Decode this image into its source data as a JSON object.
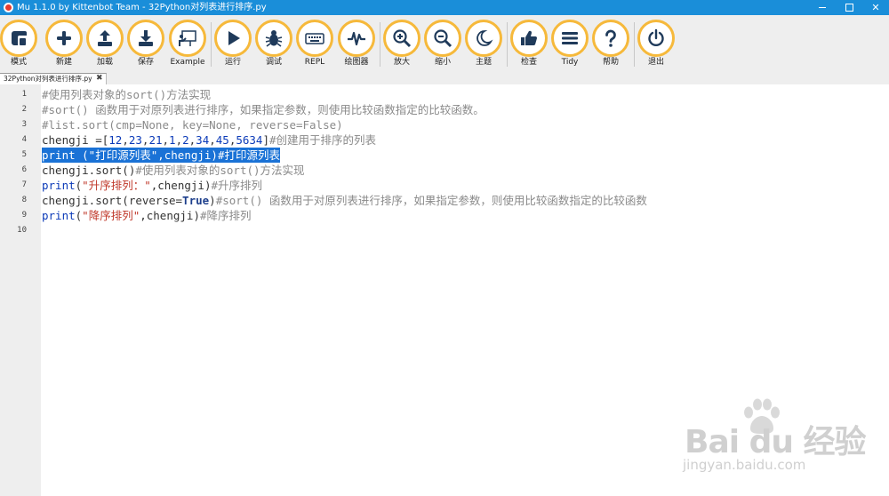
{
  "window": {
    "title": "Mu 1.1.0 by Kittenbot Team - 32Python对列表进行排序.py"
  },
  "toolbar": {
    "buttons": [
      {
        "label": "模式",
        "icon": "mode-icon"
      },
      {
        "label": "新建",
        "icon": "plus-icon"
      },
      {
        "label": "加载",
        "icon": "upload-icon"
      },
      {
        "label": "保存",
        "icon": "download-icon"
      },
      {
        "label": "Example",
        "icon": "presentation-icon"
      },
      {
        "label": "运行",
        "icon": "play-icon"
      },
      {
        "label": "调试",
        "icon": "bug-icon"
      },
      {
        "label": "REPL",
        "icon": "keyboard-icon"
      },
      {
        "label": "绘图器",
        "icon": "pulse-icon"
      },
      {
        "label": "放大",
        "icon": "zoom-in-icon"
      },
      {
        "label": "缩小",
        "icon": "zoom-out-icon"
      },
      {
        "label": "主题",
        "icon": "moon-icon"
      },
      {
        "label": "检查",
        "icon": "thumbs-up-icon"
      },
      {
        "label": "Tidy",
        "icon": "lines-icon"
      },
      {
        "label": "帮助",
        "icon": "question-icon"
      },
      {
        "label": "退出",
        "icon": "power-icon"
      }
    ]
  },
  "tab": {
    "name": "32Python对列表进行排序.py",
    "close": "✖"
  },
  "editor": {
    "line_numbers": [
      "1",
      "2",
      "3",
      "4",
      "5",
      "6",
      "7",
      "8",
      "9",
      "10"
    ],
    "lines": [
      [
        {
          "t": "#使用列表对象的sort()方法实现",
          "c": "cm"
        }
      ],
      [
        {
          "t": "#sort() 函数用于对原列表进行排序，如果指定参数，则使用比较函数指定的比较函数。",
          "c": "cm"
        }
      ],
      [
        {
          "t": "#list.sort(cmp=None, key=None, reverse=False)",
          "c": "cm"
        }
      ],
      [
        {
          "t": "chengji =[",
          "c": "plain"
        },
        {
          "t": "12",
          "c": "num"
        },
        {
          "t": ",",
          "c": "plain"
        },
        {
          "t": "23",
          "c": "num"
        },
        {
          "t": ",",
          "c": "plain"
        },
        {
          "t": "21",
          "c": "num"
        },
        {
          "t": ",",
          "c": "plain"
        },
        {
          "t": "1",
          "c": "num"
        },
        {
          "t": ",",
          "c": "plain"
        },
        {
          "t": "2",
          "c": "num"
        },
        {
          "t": ",",
          "c": "plain"
        },
        {
          "t": "34",
          "c": "num"
        },
        {
          "t": ",",
          "c": "plain"
        },
        {
          "t": "45",
          "c": "num"
        },
        {
          "t": ",",
          "c": "plain"
        },
        {
          "t": "5634",
          "c": "num"
        },
        {
          "t": "]",
          "c": "plain"
        },
        {
          "t": "#创建用于排序的列表",
          "c": "cm"
        }
      ],
      [
        {
          "t": "print (\"打印源列表\",chengji)#打印源列表",
          "c": "plain"
        }
      ],
      [
        {
          "t": "chengji.sort()",
          "c": "plain"
        },
        {
          "t": "#使用列表对象的sort()方法实现",
          "c": "cm"
        }
      ],
      [
        {
          "t": "print",
          "c": "kw"
        },
        {
          "t": "(",
          "c": "plain"
        },
        {
          "t": "\"升序排列：\"",
          "c": "str"
        },
        {
          "t": ",chengji)",
          "c": "plain"
        },
        {
          "t": "#升序排列",
          "c": "cm"
        }
      ],
      [
        {
          "t": "chengji.sort(reverse=",
          "c": "plain"
        },
        {
          "t": "True",
          "c": "bool"
        },
        {
          "t": ")",
          "c": "plain"
        },
        {
          "t": "#sort() 函数用于对原列表进行排序，如果指定参数，则使用比较函数指定的比较函数",
          "c": "cm"
        }
      ],
      [
        {
          "t": "print",
          "c": "kw"
        },
        {
          "t": "(",
          "c": "plain"
        },
        {
          "t": "\"降序排列\"",
          "c": "str"
        },
        {
          "t": ",chengji)",
          "c": "plain"
        },
        {
          "t": "#降序排列",
          "c": "cm"
        }
      ],
      []
    ],
    "selected_line": 5
  },
  "watermark": {
    "brand": "Bai du 经验",
    "url": "jingyan.baidu.com"
  },
  "colors": {
    "titlebar": "#1a8ed9",
    "button_ring": "#f6b93b",
    "icon": "#1f3a5a",
    "selection": "#1a72d6"
  }
}
